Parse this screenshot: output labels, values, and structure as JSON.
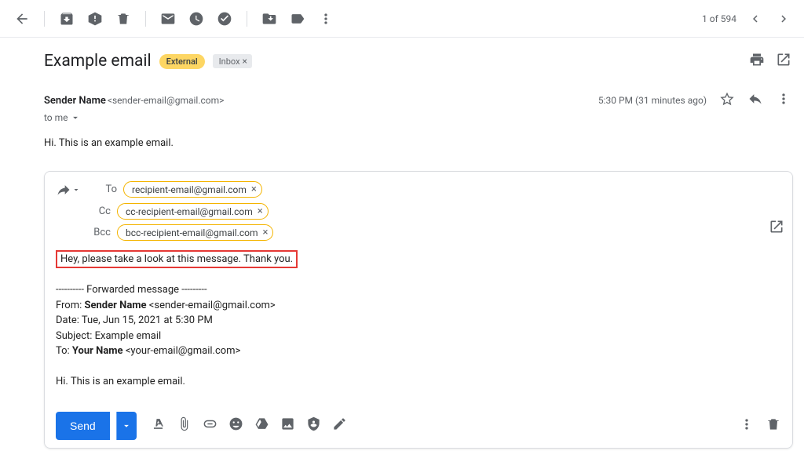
{
  "topbar": {
    "count": "1 of 594"
  },
  "subject": {
    "title": "Example email",
    "external_label": "External",
    "inbox_label": "Inbox"
  },
  "sender": {
    "name": "Sender Name",
    "addr": "<sender-email@gmail.com>",
    "time": "5:30 PM (31 minutes ago)",
    "to_line": "to me"
  },
  "body": {
    "text": "Hi. This is an example email."
  },
  "compose": {
    "to_label": "To",
    "cc_label": "Cc",
    "bcc_label": "Bcc",
    "chips": {
      "to": "recipient-email@gmail.com",
      "cc": "cc-recipient-email@gmail.com",
      "bcc": "bcc-recipient-email@gmail.com"
    },
    "highlight_text": "Hey, please take a look at this message. Thank you.",
    "fwd": {
      "divider": "---------- Forwarded message ---------",
      "from_lbl": "From: ",
      "from_name": "Sender Name",
      "from_addr": " <sender-email@gmail.com>",
      "date_lbl": "Date: ",
      "date_val": "Tue, Jun 15, 2021 at 5:30 PM",
      "subj_lbl": "Subject: ",
      "subj_val": "Example email",
      "to_lbl": "To: ",
      "to_name": "Your Name",
      "to_addr": " <your-email@gmail.com>",
      "body": "Hi. This is an example email."
    },
    "send_label": "Send"
  }
}
